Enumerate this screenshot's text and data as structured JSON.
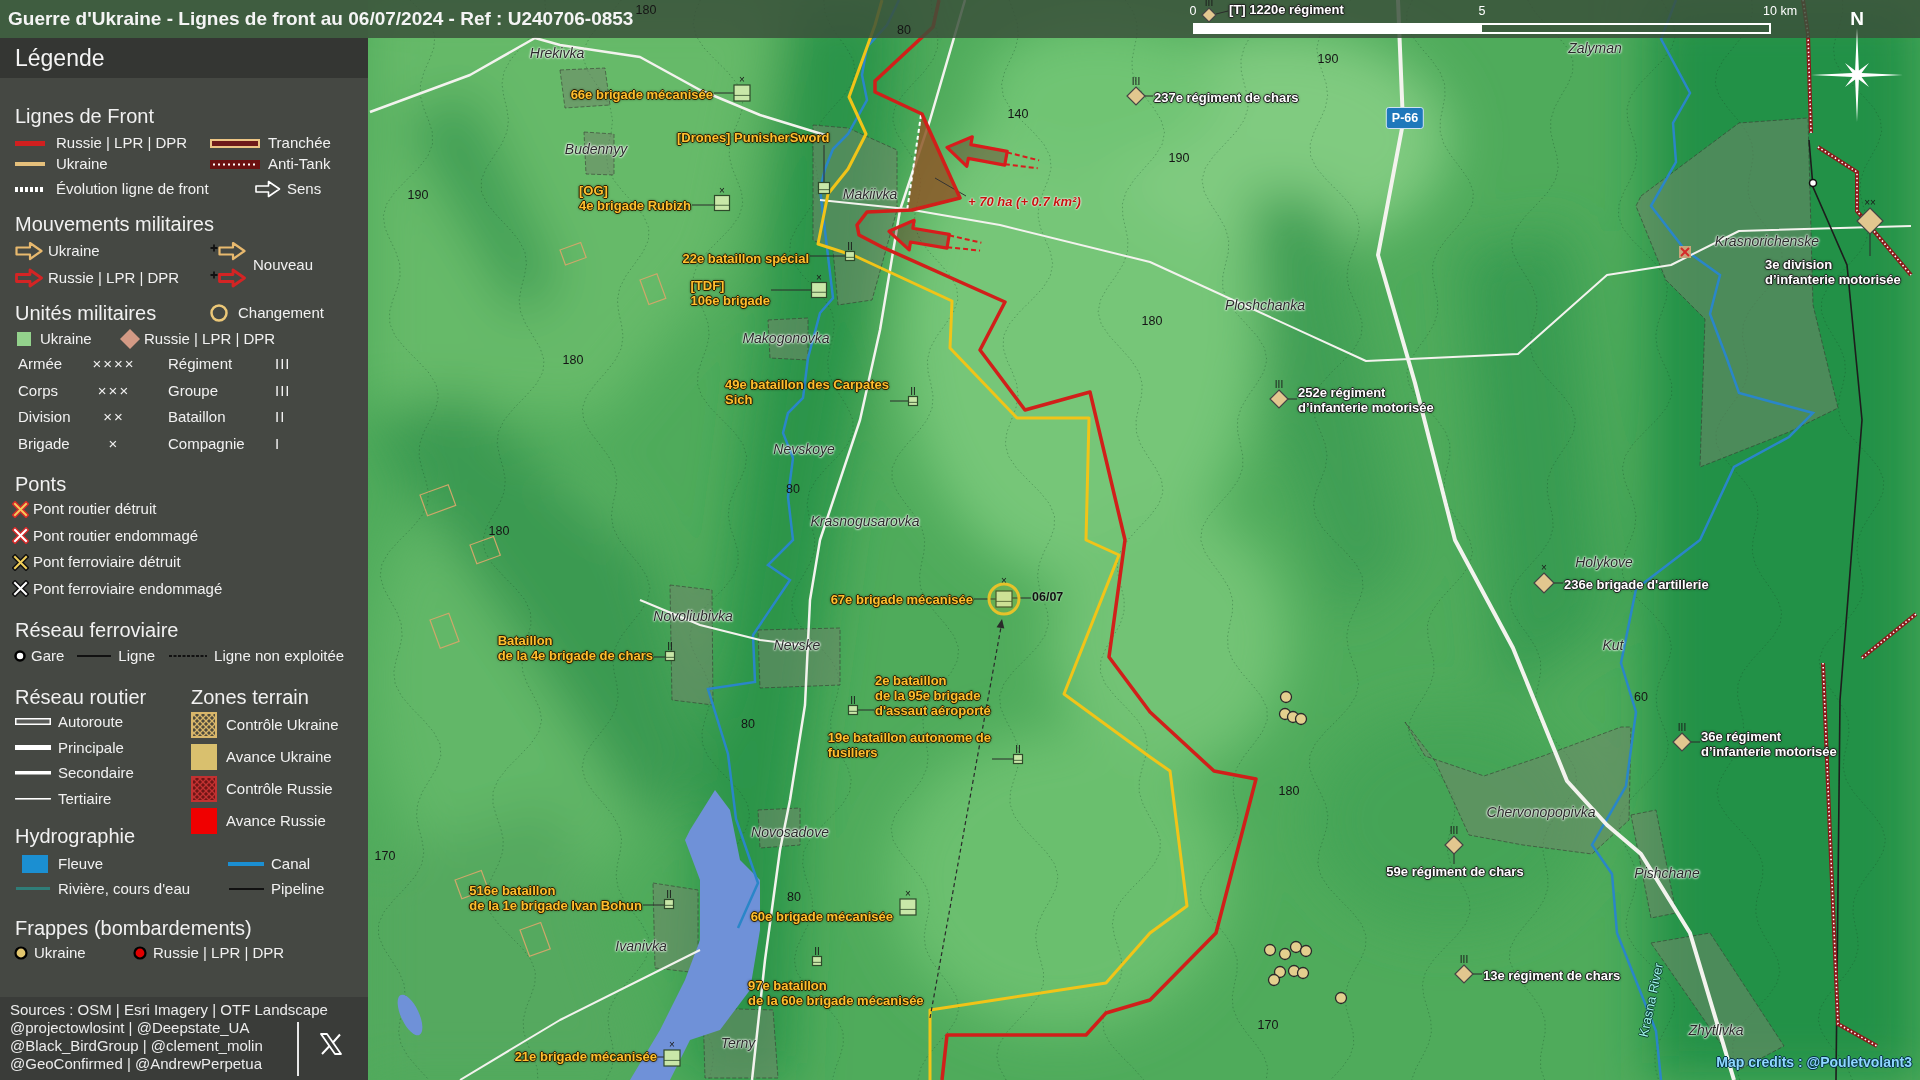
{
  "title": "Guerre d'Ukraine - Lignes de front au 06/07/2024 - Ref : U240706-0853",
  "legend": {
    "title": "Légende",
    "front_lines": {
      "heading": "Lignes de Front",
      "items": [
        {
          "kind": "russia-line",
          "label": "Russie | LPR | DPR"
        },
        {
          "kind": "trench",
          "label": "Tranchée"
        },
        {
          "kind": "ukraine-line",
          "label": "Ukraine"
        },
        {
          "kind": "antitank",
          "label": "Anti-Tank"
        },
        {
          "kind": "evolution",
          "label": "Évolution ligne de front"
        },
        {
          "kind": "direction",
          "label": "Sens"
        }
      ]
    },
    "movements": {
      "heading": "Mouvements militaires",
      "items": [
        {
          "kind": "ukraine",
          "label": "Ukraine"
        },
        {
          "kind": "russia",
          "label": "Russie | LPR | DPR"
        }
      ],
      "new_label": "Nouveau"
    },
    "units": {
      "heading": "Unités militaires",
      "change_label": "Changement",
      "sides": [
        {
          "kind": "ukraine",
          "label": "Ukraine"
        },
        {
          "kind": "russia",
          "label": "Russie | LPR | DPR"
        }
      ],
      "echelons": [
        {
          "label": "Armée",
          "mark": "××××"
        },
        {
          "label": "Régiment",
          "mark": "III"
        },
        {
          "label": "Corps",
          "mark": "×××"
        },
        {
          "label": "Groupe",
          "mark": "III"
        },
        {
          "label": "Division",
          "mark": "××"
        },
        {
          "label": "Bataillon",
          "mark": "II"
        },
        {
          "label": "Brigade",
          "mark": "×"
        },
        {
          "label": "Compagnie",
          "mark": "I"
        }
      ]
    },
    "bridges": {
      "heading": "Ponts",
      "items": [
        {
          "kind": "road-destroyed",
          "label": "Pont routier détruit"
        },
        {
          "kind": "road-damaged",
          "label": "Pont routier endommagé"
        },
        {
          "kind": "rail-destroyed",
          "label": "Pont ferroviaire détruit"
        },
        {
          "kind": "rail-damaged",
          "label": "Pont ferroviaire endommagé"
        }
      ]
    },
    "railway": {
      "heading": "Réseau ferroviaire",
      "items": [
        {
          "kind": "station",
          "label": "Gare"
        },
        {
          "kind": "line",
          "label": "Ligne"
        },
        {
          "kind": "disused",
          "label": "Ligne non exploitée"
        }
      ]
    },
    "roads": {
      "heading": "Réseau routier",
      "items": [
        {
          "kind": "motorway",
          "label": "Autoroute"
        },
        {
          "kind": "primary",
          "label": "Principale"
        },
        {
          "kind": "secondary",
          "label": "Secondaire"
        },
        {
          "kind": "tertiary",
          "label": "Tertiaire"
        }
      ]
    },
    "terrain": {
      "heading": "Zones terrain",
      "items": [
        {
          "kind": "ukraine-control",
          "label": "Contrôle Ukraine"
        },
        {
          "kind": "ukraine-advance",
          "label": "Avance Ukraine"
        },
        {
          "kind": "russia-control",
          "label": "Contrôle Russie"
        },
        {
          "kind": "russia-advance",
          "label": "Avance Russie"
        }
      ]
    },
    "hydrography": {
      "heading": "Hydrographie",
      "items": [
        {
          "kind": "river",
          "label": "Fleuve"
        },
        {
          "kind": "canal",
          "label": "Canal"
        },
        {
          "kind": "stream",
          "label": "Rivière, cours d'eau"
        },
        {
          "kind": "pipeline",
          "label": "Pipeline"
        }
      ]
    },
    "strikes": {
      "heading": "Frappes (bombardements)",
      "items": [
        {
          "kind": "ukraine",
          "label": "Ukraine"
        },
        {
          "kind": "russia",
          "label": "Russie | LPR | DPR"
        }
      ]
    },
    "sources": "Sources : OSM | Esri Imagery | OTF Landscape",
    "handles": [
      "@projectowlosint | @Deepstate_UA",
      "@Black_BirdGroup | @clement_molin",
      "@GeoConfirmed | @AndrewPerpetua"
    ]
  },
  "map": {
    "scale_bar": [
      "0",
      "5",
      "10 km"
    ],
    "compass": "N",
    "places": [
      "Hrekivka",
      "Zalyman",
      "Budennyy",
      "Makiivka",
      "Krasnorichenske",
      "Ploshchanka",
      "Makogonovka",
      "Nevskoye",
      "Krasnogusarovka",
      "Holykove",
      "Novoliubivka",
      "Nevske",
      "Kut",
      "Chervonopopivka",
      "Novosadove",
      "Pishchane",
      "Ivanivka",
      "Zhytlivka",
      "Terny"
    ],
    "elevations": [
      "180",
      "80",
      "190",
      "140",
      "190",
      "190",
      "180",
      "180",
      "80",
      "180",
      "60",
      "80",
      "180",
      "170",
      "80",
      "170"
    ],
    "road_numbers": [
      "P-66"
    ],
    "water_labels": [
      "Krasna River"
    ],
    "annotations": [
      "+ 70 ha (+ 0.7 km²)"
    ],
    "units": [
      {
        "kind": "russia",
        "echelon": "III",
        "lines": [
          "[T] 1220e régiment"
        ],
        "changed": false
      },
      {
        "kind": "ukraine",
        "echelon": "×",
        "lines": [
          "66e brigade mécanisée"
        ],
        "changed": false
      },
      {
        "kind": "russia",
        "echelon": "III",
        "lines": [
          "237e régiment de chars"
        ],
        "changed": false
      },
      {
        "kind": "ukraine",
        "lines": [
          "[Drones] PunisherSword"
        ],
        "changed": false
      },
      {
        "kind": "ukraine",
        "echelon": "×",
        "lines": [
          "[OG]",
          "4e brigade Rubizh"
        ],
        "changed": false
      },
      {
        "kind": "ukraine",
        "echelon": "II",
        "lines": [
          "22e bataillon spécial"
        ],
        "changed": false
      },
      {
        "kind": "russia",
        "echelon": "××",
        "lines": [
          "3e division",
          "d’infanterie motorisée"
        ],
        "changed": false
      },
      {
        "kind": "ukraine",
        "echelon": "×",
        "lines": [
          "[TDF]",
          "106e brigade"
        ],
        "changed": false
      },
      {
        "kind": "ukraine",
        "echelon": "II",
        "lines": [
          "49e bataillon des Carpates",
          "Sich"
        ],
        "changed": false
      },
      {
        "kind": "russia",
        "echelon": "III",
        "lines": [
          "252e régiment",
          "d’infanterie motorisée"
        ],
        "changed": false
      },
      {
        "kind": "russia",
        "echelon": "×",
        "lines": [
          "236e brigade d'artillerie"
        ],
        "changed": false
      },
      {
        "kind": "ukraine",
        "echelon": "×",
        "lines": [
          "67e brigade mécanisée"
        ],
        "changed": true,
        "date": "06/07"
      },
      {
        "kind": "ukraine",
        "echelon": "II",
        "lines": [
          "Bataillon",
          "de la 4e brigade de chars"
        ],
        "changed": false
      },
      {
        "kind": "ukraine",
        "echelon": "II",
        "lines": [
          "2e bataillon",
          "de la 95e brigade",
          "d'assaut aéroporté"
        ],
        "changed": false
      },
      {
        "kind": "ukraine",
        "echelon": "II",
        "lines": [
          "19e bataillon autonome de",
          "fusiliers"
        ],
        "changed": false
      },
      {
        "kind": "russia",
        "echelon": "III",
        "lines": [
          "36e régiment",
          "d’infanterie motorisée"
        ],
        "changed": false
      },
      {
        "kind": "russia",
        "echelon": "III",
        "lines": [
          "59e régiment de chars"
        ],
        "changed": false
      },
      {
        "kind": "ukraine",
        "echelon": "II",
        "lines": [
          "516e bataillon",
          "de la 1e brigade Ivan Bohun"
        ],
        "changed": false
      },
      {
        "kind": "ukraine",
        "echelon": "×",
        "lines": [
          "60e brigade mécanisée"
        ],
        "changed": false
      },
      {
        "kind": "russia",
        "echelon": "III",
        "lines": [
          "13e régiment de chars"
        ],
        "changed": false
      },
      {
        "kind": "ukraine",
        "echelon": "II",
        "lines": [
          "97e bataillon",
          "de la 60e brigade mécanisée"
        ],
        "changed": false
      },
      {
        "kind": "ukraine",
        "echelon": "×",
        "lines": [
          "21e brigade mécanisée"
        ],
        "changed": false
      }
    ],
    "credits": "Map credits : @Pouletvolant3"
  }
}
